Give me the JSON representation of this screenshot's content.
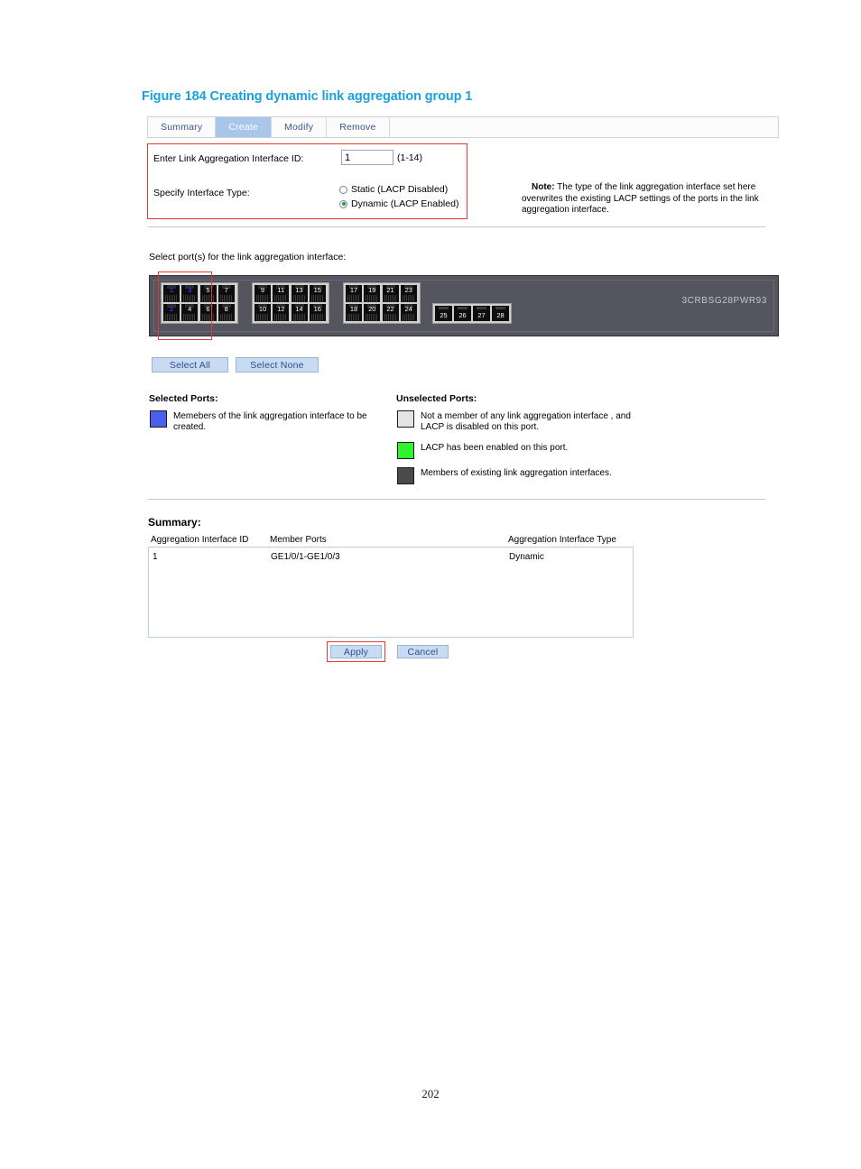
{
  "figure": {
    "caption": "Figure 184 Creating dynamic link aggregation group 1"
  },
  "tabs": [
    {
      "label": "Summary",
      "active": false
    },
    {
      "label": "Create",
      "active": true
    },
    {
      "label": "Modify",
      "active": false
    },
    {
      "label": "Remove",
      "active": false
    }
  ],
  "form": {
    "id_label": "Enter Link Aggregation Interface ID:",
    "id_value": "1",
    "id_range": "(1-14)",
    "type_label": "Specify Interface Type:",
    "options": [
      {
        "label": "Static (LACP Disabled)",
        "checked": false
      },
      {
        "label": "Dynamic (LACP Enabled)",
        "checked": true
      }
    ]
  },
  "note": {
    "prefix": "Note:",
    "line1": "The type of the link aggregation interface set here",
    "line2": "overwrites the existing LACP settings of the ports in the",
    "line3": "link aggregation interface."
  },
  "ports_section": {
    "instruction": "Select port(s) for the link aggregation interface:",
    "device_model": "3CRBSG28PWR93",
    "banks": [
      {
        "ports": [
          {
            "num": "1",
            "selected": true
          },
          {
            "num": "3",
            "selected": true
          },
          {
            "num": "5",
            "selected": false
          },
          {
            "num": "7",
            "selected": false
          },
          {
            "num": "2",
            "selected": true
          },
          {
            "num": "4",
            "selected": false
          },
          {
            "num": "6",
            "selected": false
          },
          {
            "num": "8",
            "selected": false
          }
        ]
      },
      {
        "ports": [
          {
            "num": "9",
            "selected": false
          },
          {
            "num": "11",
            "selected": false
          },
          {
            "num": "13",
            "selected": false
          },
          {
            "num": "15",
            "selected": false
          },
          {
            "num": "10",
            "selected": false
          },
          {
            "num": "12",
            "selected": false
          },
          {
            "num": "14",
            "selected": false
          },
          {
            "num": "16",
            "selected": false
          }
        ]
      },
      {
        "ports": [
          {
            "num": "17",
            "selected": false
          },
          {
            "num": "19",
            "selected": false
          },
          {
            "num": "21",
            "selected": false
          },
          {
            "num": "23",
            "selected": false
          },
          {
            "num": "18",
            "selected": false
          },
          {
            "num": "20",
            "selected": false
          },
          {
            "num": "22",
            "selected": false
          },
          {
            "num": "24",
            "selected": false
          }
        ]
      }
    ],
    "sfp_ports": [
      {
        "num": "25"
      },
      {
        "num": "26"
      },
      {
        "num": "27"
      },
      {
        "num": "28"
      }
    ],
    "select_all_label": "Select All",
    "select_none_label": "Select None"
  },
  "legend": {
    "selected_title": "Selected Ports:",
    "unselected_title": "Unselected Ports:",
    "selected_items": [
      {
        "color": "#4a5ef0",
        "text": "Memebers of the link aggregation interface to be\ncreated."
      }
    ],
    "unselected_items": [
      {
        "color": "#e4e4e4",
        "text": "Not a member of any link aggregation interface , and\nLACP is disabled on this port."
      },
      {
        "color": "#2ff32f",
        "text": "LACP has been enabled on this port."
      },
      {
        "color": "#4a4a4a",
        "text": "Members of existing link aggregation interfaces."
      }
    ]
  },
  "summary": {
    "title": "Summary:",
    "columns": [
      "Aggregation Interface ID",
      "Member Ports",
      "Aggregation Interface Type"
    ],
    "rows": [
      {
        "id": "1",
        "member_ports": "GE1/0/1-GE1/0/3",
        "type": "Dynamic"
      }
    ]
  },
  "actions": {
    "apply_label": "Apply",
    "cancel_label": "Cancel"
  },
  "page": {
    "number": "202"
  }
}
